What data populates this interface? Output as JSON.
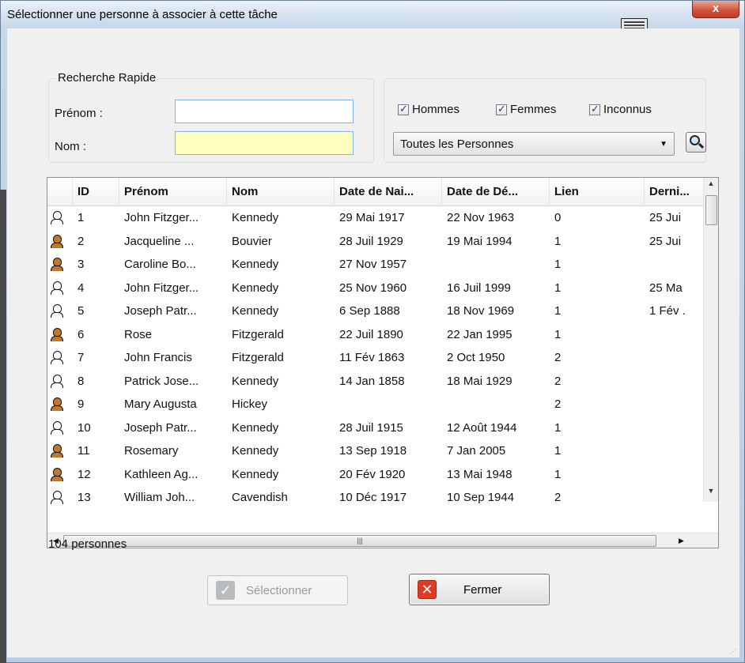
{
  "window": {
    "title": "Sélectionner une personne à associer à cette tâche",
    "close_label": "x"
  },
  "quick_search": {
    "legend": "Recherche Rapide",
    "firstname_label": "Prénom :",
    "firstname_value": "",
    "lastname_label": "Nom :",
    "lastname_value": ""
  },
  "filters": {
    "men_label": "Hommes",
    "women_label": "Femmes",
    "unknown_label": "Inconnus",
    "men_checked": true,
    "women_checked": true,
    "unknown_checked": true,
    "scope_selected": "Toutes les Personnes"
  },
  "table": {
    "columns": [
      "ID",
      "Prénom",
      "Nom",
      "Date de Nai...",
      "Date de Dé...",
      "Lien",
      "Derni..."
    ],
    "rows": [
      {
        "id": "1",
        "prenom": "John Fitzger...",
        "nom": "Kennedy",
        "naissance": "29 Mai 1917",
        "deces": "22 Nov 1963",
        "lien": "0",
        "dernier": "25 Jui",
        "sex": "male"
      },
      {
        "id": "2",
        "prenom": "Jacqueline ...",
        "nom": "Bouvier",
        "naissance": "28 Juil 1929",
        "deces": "19 Mai 1994",
        "lien": "1",
        "dernier": "25 Jui",
        "sex": "female"
      },
      {
        "id": "3",
        "prenom": "Caroline Bo...",
        "nom": "Kennedy",
        "naissance": "27 Nov 1957",
        "deces": "",
        "lien": "1",
        "dernier": "",
        "sex": "female"
      },
      {
        "id": "4",
        "prenom": "John Fitzger...",
        "nom": "Kennedy",
        "naissance": "25 Nov 1960",
        "deces": "16 Juil 1999",
        "lien": "1",
        "dernier": "25 Ma",
        "sex": "male"
      },
      {
        "id": "5",
        "prenom": "Joseph Patr...",
        "nom": "Kennedy",
        "naissance": "6 Sep 1888",
        "deces": "18 Nov 1969",
        "lien": "1",
        "dernier": "1 Fév .",
        "sex": "male"
      },
      {
        "id": "6",
        "prenom": "Rose",
        "nom": "Fitzgerald",
        "naissance": "22 Juil 1890",
        "deces": "22 Jan 1995",
        "lien": "1",
        "dernier": "",
        "sex": "female"
      },
      {
        "id": "7",
        "prenom": "John Francis",
        "nom": "Fitzgerald",
        "naissance": "11 Fév 1863",
        "deces": "2 Oct 1950",
        "lien": "2",
        "dernier": "",
        "sex": "male"
      },
      {
        "id": "8",
        "prenom": "Patrick Jose...",
        "nom": "Kennedy",
        "naissance": "14 Jan 1858",
        "deces": "18 Mai 1929",
        "lien": "2",
        "dernier": "",
        "sex": "male"
      },
      {
        "id": "9",
        "prenom": "Mary Augusta",
        "nom": "Hickey",
        "naissance": "",
        "deces": "",
        "lien": "2",
        "dernier": "",
        "sex": "female"
      },
      {
        "id": "10",
        "prenom": "Joseph Patr...",
        "nom": "Kennedy",
        "naissance": "28 Juil 1915",
        "deces": "12 Août 1944",
        "lien": "1",
        "dernier": "",
        "sex": "male"
      },
      {
        "id": "11",
        "prenom": "Rosemary",
        "nom": "Kennedy",
        "naissance": "13 Sep 1918",
        "deces": "7 Jan 2005",
        "lien": "1",
        "dernier": "",
        "sex": "female"
      },
      {
        "id": "12",
        "prenom": "Kathleen Ag...",
        "nom": "Kennedy",
        "naissance": "20 Fév 1920",
        "deces": "13 Mai 1948",
        "lien": "1",
        "dernier": "",
        "sex": "female"
      },
      {
        "id": "13",
        "prenom": "William Joh...",
        "nom": "Cavendish",
        "naissance": "10 Déc 1917",
        "deces": "10 Sep 1944",
        "lien": "2",
        "dernier": "",
        "sex": "male"
      }
    ]
  },
  "status": {
    "count_text": "104 personnes"
  },
  "buttons": {
    "select_label": "Sélectionner",
    "close_label": "Fermer"
  },
  "icons": {
    "male_color": "#111111",
    "female_color": "#c07830",
    "close_color": "#e03a24",
    "check_color": "#b9bcbf"
  }
}
